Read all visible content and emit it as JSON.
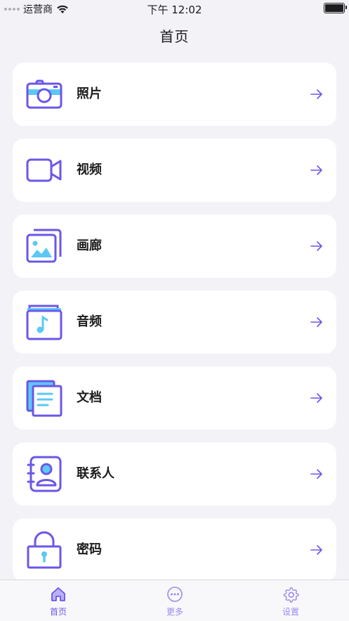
{
  "status_bar": {
    "carrier": "运营商",
    "time": "下午 12:02"
  },
  "nav": {
    "title": "首页"
  },
  "accent_color": "#6a57e8",
  "highlight_color": "#5cc8f5",
  "menu": [
    {
      "label": "照片",
      "icon": "camera-icon"
    },
    {
      "label": "视频",
      "icon": "video-camera-icon"
    },
    {
      "label": "画廊",
      "icon": "gallery-icon"
    },
    {
      "label": "音频",
      "icon": "music-note-icon"
    },
    {
      "label": "文档",
      "icon": "document-icon"
    },
    {
      "label": "联系人",
      "icon": "contacts-icon"
    },
    {
      "label": "密码",
      "icon": "lock-icon"
    }
  ],
  "tabs": [
    {
      "label": "首页",
      "icon": "home-icon",
      "active": true
    },
    {
      "label": "更多",
      "icon": "more-icon",
      "active": false
    },
    {
      "label": "设置",
      "icon": "settings-icon",
      "active": false
    }
  ]
}
